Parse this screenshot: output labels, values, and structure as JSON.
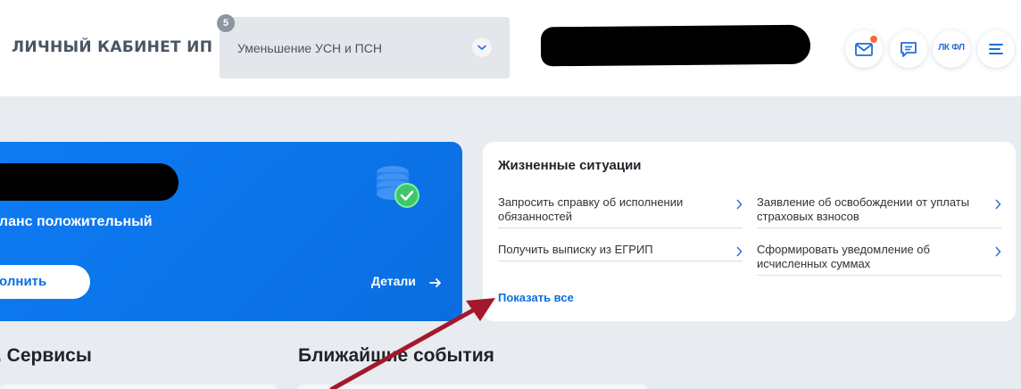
{
  "header": {
    "logo": "ЛИЧНЫЙ КАБИНЕТ ИП",
    "mode_select": {
      "value": "Уменьшение УСН и ПСН",
      "badge": "5"
    },
    "icons": {
      "mail": "mail-icon",
      "chat": "chat-icon",
      "lk_fl": "ЛК ФЛ",
      "menu": "menu-icon"
    },
    "colors": {
      "accent": "#1f6fd6",
      "notification": "#f26b3a"
    }
  },
  "balance": {
    "status": "аланс положительный",
    "topup_label": "полнить",
    "details_label": "Детали",
    "coin_icon": "coins-check-icon"
  },
  "situations": {
    "title": "Жизненные ситуации",
    "items": [
      {
        "label": "Запросить справку об исполнении обязанностей"
      },
      {
        "label": "Заявление об освобождении от уплаты страховых взносов"
      },
      {
        "label": "Получить выписку из ЕГРИП"
      },
      {
        "label": "Сформировать уведомление об исчисленных суммах"
      }
    ],
    "show_all": "Показать все"
  },
  "sections": {
    "services": ". Сервисы",
    "events": "Ближайшие события"
  },
  "colors": {
    "card_blue": "#0a6ee0",
    "background": "#e8ecf1",
    "annotation_arrow": "#a3182a"
  }
}
